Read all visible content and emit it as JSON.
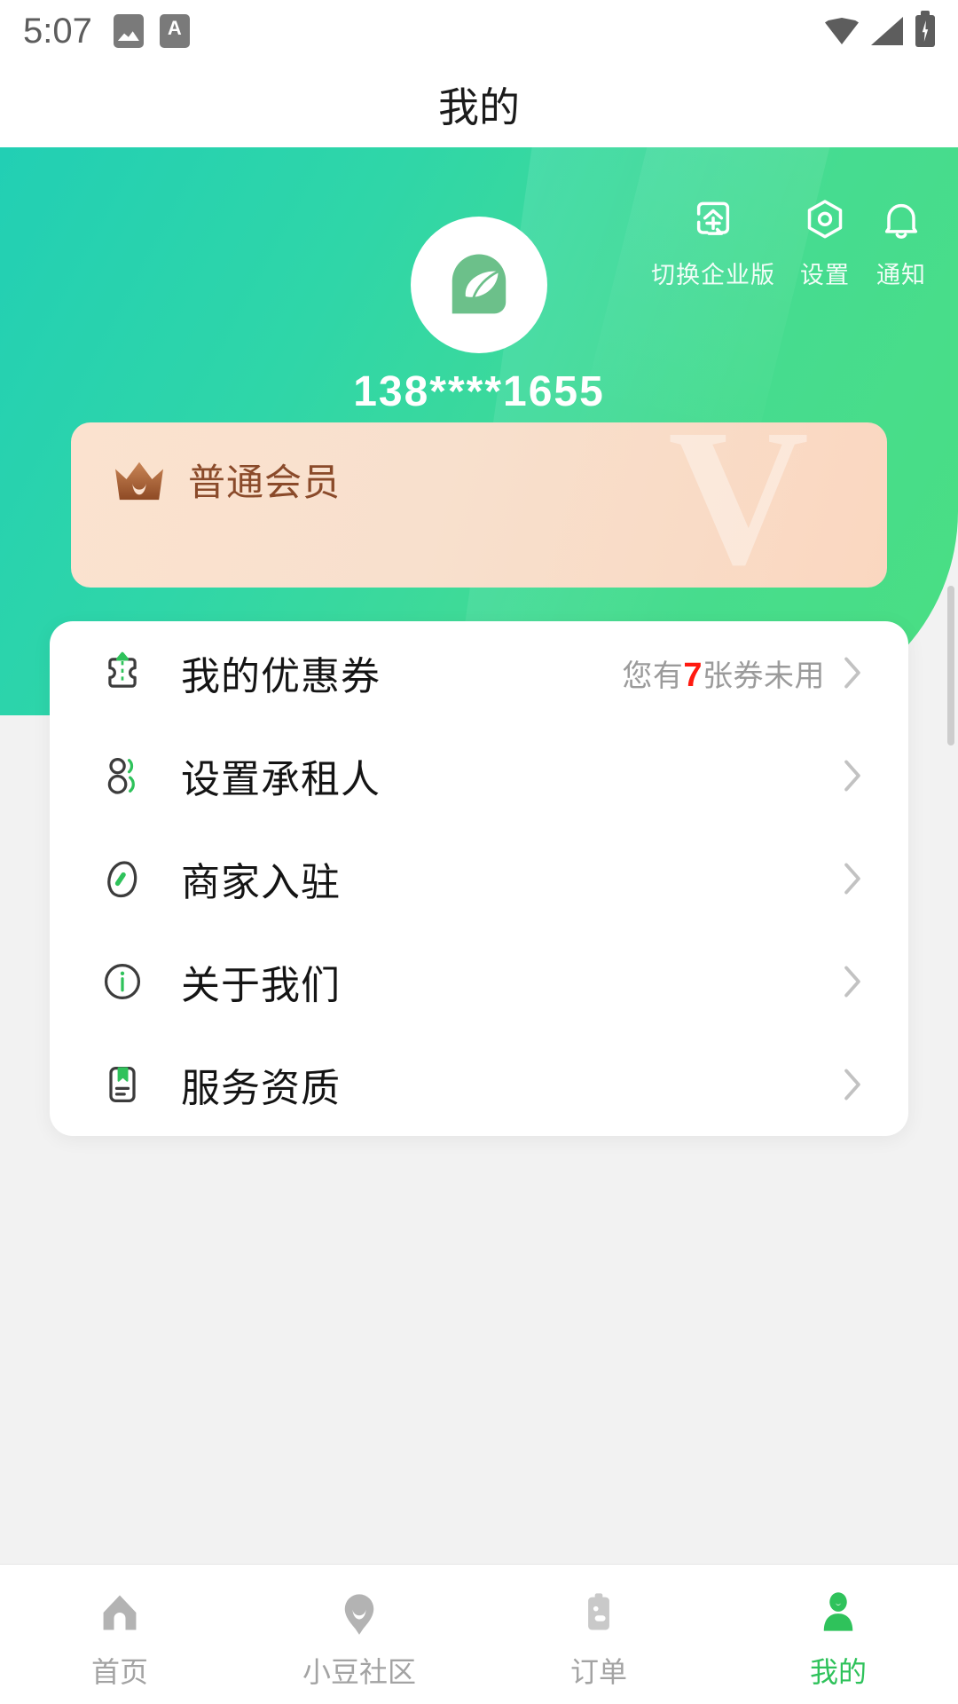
{
  "statusbar": {
    "time": "5:07",
    "left_icons": [
      "image-icon",
      "app-a-icon"
    ],
    "right_icons": [
      "wifi-icon",
      "signal-icon",
      "battery-charging-icon"
    ],
    "letter_icon_text": "A"
  },
  "header": {
    "title": "我的"
  },
  "profile": {
    "phone": "138****1655",
    "avatar_icon": "leaf-logo-avatar",
    "actions": [
      {
        "label": "切换企业版",
        "icon": "enterprise-switch-icon"
      },
      {
        "label": "设置",
        "icon": "gear-hexagon-icon"
      },
      {
        "label": "通知",
        "icon": "bell-icon"
      }
    ]
  },
  "member_card": {
    "level": "普通会员",
    "icon": "crown-icon",
    "watermark": "V"
  },
  "menu": {
    "items": [
      {
        "label": "我的优惠券",
        "icon": "coupon-icon",
        "note_prefix": "您有",
        "note_count": "7",
        "note_suffix": "张券未用",
        "chevron": "chevron-right-icon"
      },
      {
        "label": "设置承租人",
        "icon": "tenants-icon",
        "note_prefix": "",
        "note_count": "",
        "note_suffix": "",
        "chevron": "chevron-right-icon"
      },
      {
        "label": "商家入驻",
        "icon": "merchant-tag-icon",
        "note_prefix": "",
        "note_count": "",
        "note_suffix": "",
        "chevron": "chevron-right-icon"
      },
      {
        "label": "关于我们",
        "icon": "info-circle-icon",
        "note_prefix": "",
        "note_count": "",
        "note_suffix": "",
        "chevron": "chevron-right-icon"
      },
      {
        "label": "服务资质",
        "icon": "certificate-icon",
        "note_prefix": "",
        "note_count": "",
        "note_suffix": "",
        "chevron": "chevron-right-icon"
      }
    ]
  },
  "tabbar": {
    "items": [
      {
        "label": "首页",
        "icon": "home-icon",
        "active": false
      },
      {
        "label": "小豆社区",
        "icon": "community-bubble-icon",
        "active": false
      },
      {
        "label": "订单",
        "icon": "orders-clipboard-icon",
        "active": false
      },
      {
        "label": "我的",
        "icon": "person-icon",
        "active": true
      }
    ]
  },
  "colors": {
    "brand_green": "#2fc25b",
    "hero_gradient_start": "#22cfb4",
    "hero_gradient_end": "#4ade82",
    "accent_red": "#ff1a10",
    "member_bronze": "#8a4a2a",
    "inactive_gray": "#a3a3a3"
  }
}
